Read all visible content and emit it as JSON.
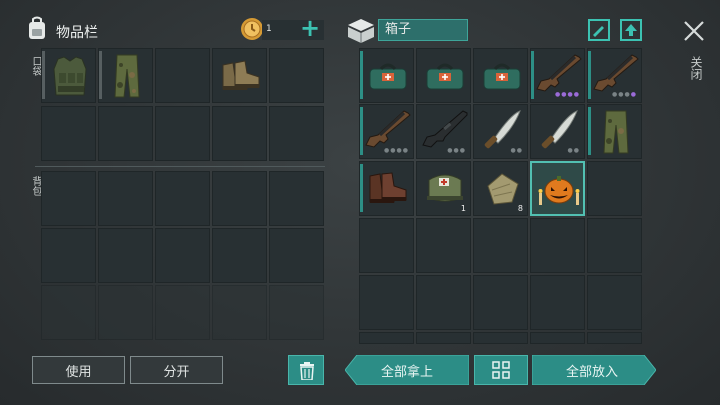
{
  "inventory": {
    "title": "物品栏",
    "pockets_label": "口袋",
    "backpack_label": "背包",
    "coin_count": "1",
    "use_button": "使用",
    "split_button": "分开"
  },
  "chest": {
    "title": "箱子",
    "take_all_button": "全部拿上",
    "put_all_button": "全部放入",
    "close_label": "关闭",
    "items": [
      {
        "name": "medkit-bag-icon",
        "count": ""
      },
      {
        "name": "medkit-bag-icon",
        "count": ""
      },
      {
        "name": "medkit-bag-icon",
        "count": ""
      },
      {
        "name": "ak-rifle-icon",
        "count": ""
      },
      {
        "name": "ak-rifle-icon",
        "count": ""
      },
      {
        "name": "ak-rifle-icon",
        "count": ""
      },
      {
        "name": "m16-rifle-icon",
        "count": ""
      },
      {
        "name": "machete-icon",
        "count": ""
      },
      {
        "name": "machete-icon",
        "count": ""
      },
      {
        "name": "camo-pants-icon",
        "count": ""
      },
      {
        "name": "leather-boots-icon",
        "count": ""
      },
      {
        "name": "first-aid-bag-icon",
        "count": "1"
      },
      {
        "name": "cloth-scrap-icon",
        "count": "8"
      },
      {
        "name": "pumpkin-lantern-icon",
        "count": ""
      }
    ]
  },
  "colors": {
    "accent": "#2c8d86",
    "purple_rarity": "#9b6bd8",
    "background": "#2f3436"
  }
}
